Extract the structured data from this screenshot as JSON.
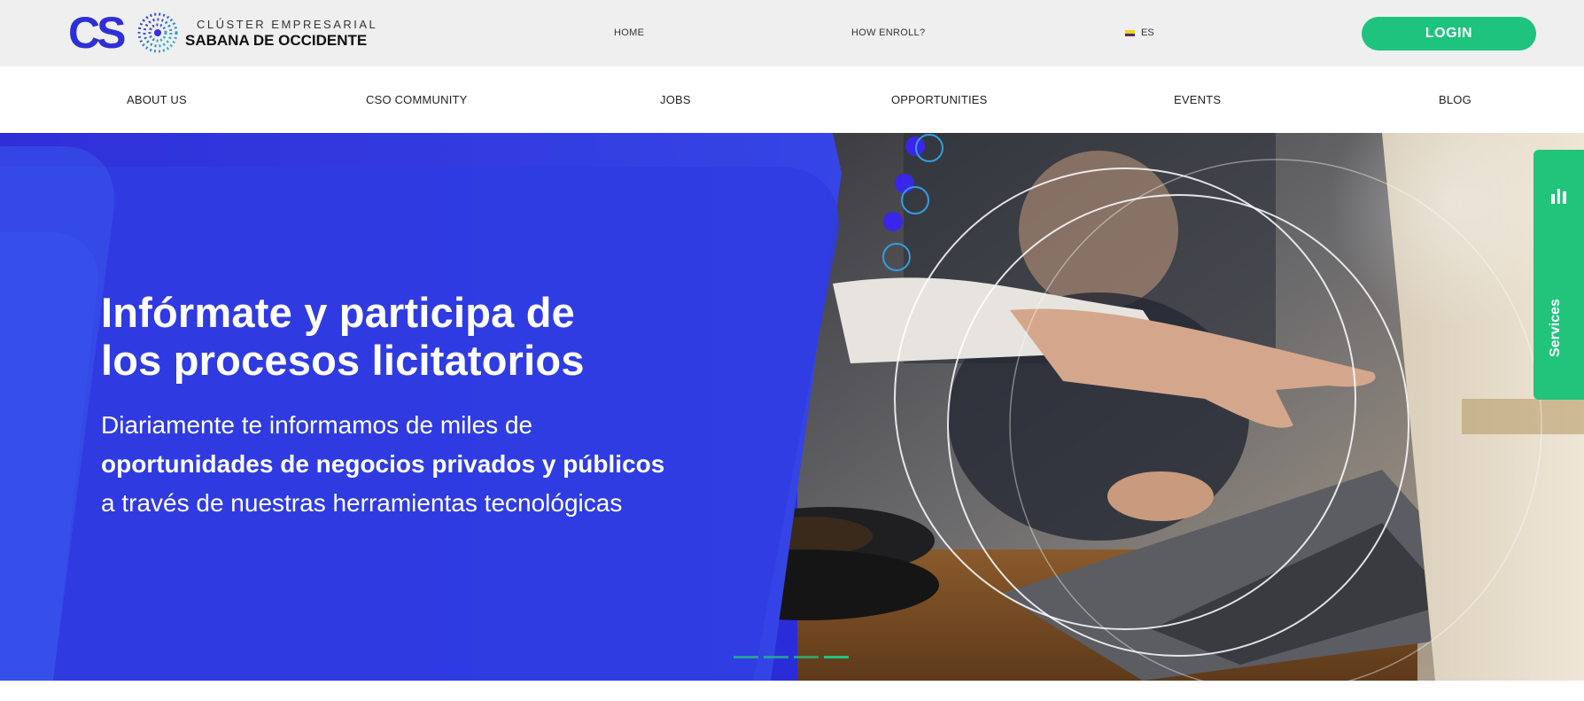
{
  "brand": {
    "logo_letters": "CS",
    "line1": "CLÚSTER EMPRESARIAL",
    "line2": "SABANA DE OCCIDENTE"
  },
  "topnav": {
    "home": "HOME",
    "enroll": "HOW ENROLL?",
    "lang_code": "ES",
    "login": "LOGIN"
  },
  "mainnav": {
    "items": [
      "ABOUT US",
      "CSO COMMUNITY",
      "JOBS",
      "OPPORTUNITIES",
      "EVENTS",
      "BLOG"
    ]
  },
  "hero": {
    "title_line1": "Infórmate y participa de",
    "title_line2": "los procesos licitatorios",
    "sub_line1": "Diariamente te informamos de miles de",
    "sub_line2": "oportunidades de negocios privados y públicos",
    "sub_line3": "a través de nuestras herramientas tecnológicas",
    "active_slide": 4,
    "slide_count": 4
  },
  "services_tab": {
    "label": "Services",
    "icon": "bars-icon"
  },
  "colors": {
    "accent_green": "#1ec37d",
    "hero_blue": "#2a2cd9",
    "topbar_bg": "#efefef"
  }
}
